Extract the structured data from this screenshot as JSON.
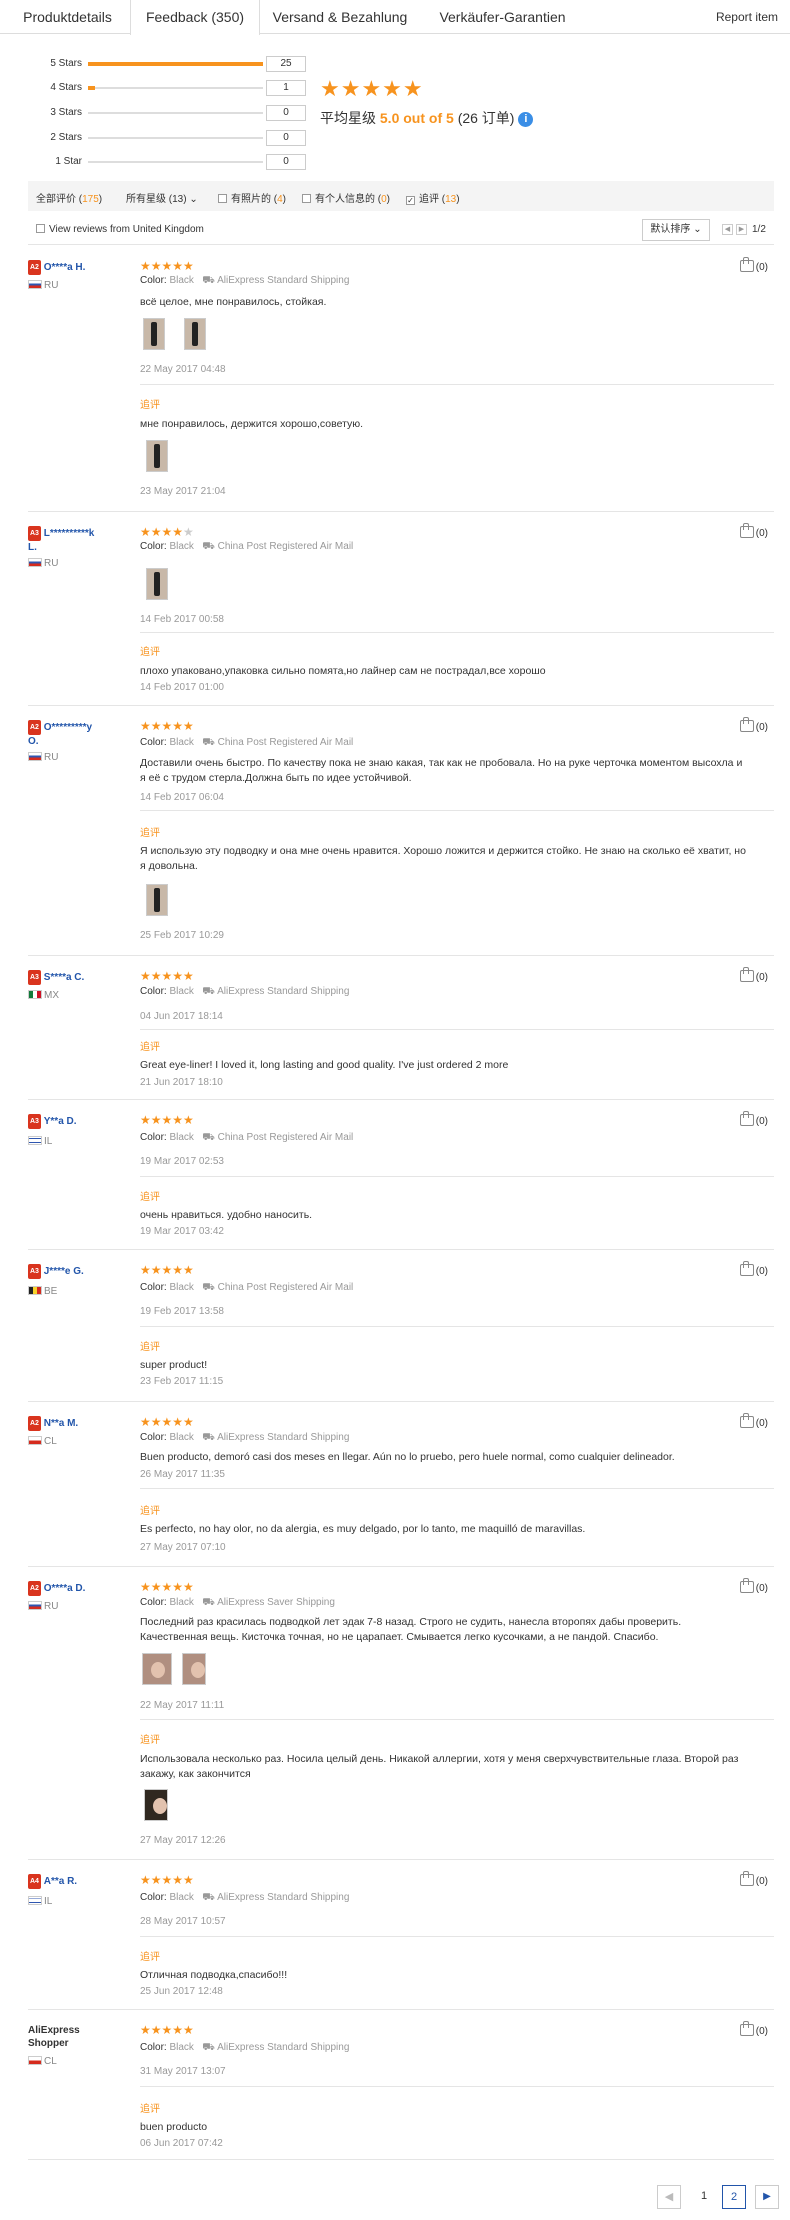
{
  "tabs": [
    "Produktdetails",
    "Feedback (350)",
    "Versand & Bezahlung",
    "Verkäufer-Garantien"
  ],
  "report_item": "Report item",
  "star_summary": [
    {
      "label": "5 Stars",
      "count": "25",
      "fraction": 1.0
    },
    {
      "label": "4 Stars",
      "count": "1",
      "fraction": 0.04
    },
    {
      "label": "3 Stars",
      "count": "0",
      "fraction": 0
    },
    {
      "label": "2 Stars",
      "count": "0",
      "fraction": 0
    },
    {
      "label": "1 Star",
      "count": "0",
      "fraction": 0
    }
  ],
  "average": {
    "prefix": "平均星级",
    "value": "5.0 out of 5",
    "orders": "(26 订单)",
    "stars": "★★★★★"
  },
  "filters": {
    "all_label": "全部评价 (",
    "all_count": "175",
    "all_close": ")",
    "all_stars": "所有星级 (13)",
    "with_photos": "有照片的 (",
    "with_photos_count": "4",
    "with_photos_close": ")",
    "with_personal": "有个人信息的 (",
    "with_personal_count": "0",
    "with_personal_close": ")",
    "additional": "追评 (",
    "additional_count": "13",
    "additional_close": ")"
  },
  "view_uk": "View reviews from United Kingdom",
  "sort_label": "默认排序",
  "page_count": "1/2",
  "labels": {
    "color": "Color:",
    "additional": "追评",
    "useful": "(0)"
  },
  "reviews": [
    {
      "level": "A2",
      "name": "O****a H.",
      "country": "RU",
      "stars": 5,
      "color": "Black",
      "shipping": "AliExpress Standard Shipping",
      "text": "всё целое, мне понравилось, стойкая.",
      "date": "22 May 2017 04:48",
      "add_text": "мне понравилось, держится хорошо,советую.",
      "add_date": "23 May 2017 21:04"
    },
    {
      "level": "A3",
      "name": "L**********k",
      "name2": "L.",
      "country": "RU",
      "stars": 4,
      "color": "Black",
      "shipping": "China Post Registered Air Mail",
      "text": "",
      "date": "14 Feb 2017 00:58",
      "add_text": "плохо упаковано,упаковка сильно помята,но лайнер сам не пострадал,все хорошо",
      "add_date": "14 Feb 2017 01:00"
    },
    {
      "level": "A2",
      "name": "O*********y",
      "name2": "O.",
      "country": "RU",
      "stars": 5,
      "color": "Black",
      "shipping": "China Post Registered Air Mail",
      "text": "Доставили очень быстро. По качеству пока не знаю какая, так как не пробовала. Но на руке черточка моментом высохла и я её с трудом стерла.Должна быть по идее устойчивой.",
      "date": "14 Feb 2017 06:04",
      "add_text": "Я использую эту подводку и она мне очень нравится. Хорошо ложится и держится стойко. Не знаю на сколько её хватит, но я довольна.",
      "add_date": "25 Feb 2017 10:29"
    },
    {
      "level": "A3",
      "name": "S****a C.",
      "country": "MX",
      "stars": 5,
      "color": "Black",
      "shipping": "AliExpress Standard Shipping",
      "text": "",
      "date": "04 Jun 2017 18:14",
      "add_text": "Great eye-liner! I loved it, long lasting and good quality. I've just ordered 2 more",
      "add_date": "21 Jun 2017 18:10"
    },
    {
      "level": "A3",
      "name": "Y**a D.",
      "country": "IL",
      "stars": 5,
      "color": "Black",
      "shipping": "China Post Registered Air Mail",
      "text": "",
      "date": "19 Mar 2017 02:53",
      "add_text": "очень нравиться. удобно наносить.",
      "add_date": "19 Mar 2017 03:42"
    },
    {
      "level": "A3",
      "name": "J****e G.",
      "country": "BE",
      "stars": 5,
      "color": "Black",
      "shipping": "China Post Registered Air Mail",
      "text": "",
      "date": "19 Feb 2017 13:58",
      "add_text": "super product!",
      "add_date": "23 Feb 2017 11:15"
    },
    {
      "level": "A2",
      "name": "N**a M.",
      "country": "CL",
      "stars": 5,
      "color": "Black",
      "shipping": "AliExpress Standard Shipping",
      "text": "Buen producto, demoró casi dos meses en llegar. Aún no lo pruebo, pero huele normal, como cualquier delineador.",
      "date": "26 May 2017 11:35",
      "add_text": "Es perfecto, no hay olor, no da alergia, es muy delgado, por lo tanto, me maquilló de maravillas.",
      "add_date": "27 May 2017 07:10"
    },
    {
      "level": "A2",
      "name": "O****a D.",
      "country": "RU",
      "stars": 5,
      "color": "Black",
      "shipping": "AliExpress Saver Shipping",
      "text": "Последний раз красилась подводкой лет эдак 7-8 назад. Строго не судить, нанесла второпях дабы проверить. Качественная вещь. Кисточка точная, но не царапает. Смывается легко кусочками, а не пандой. Спасибо.",
      "date": "22 May 2017 11:11",
      "add_text": "Использовала несколько раз. Носила целый день. Никакой аллергии, хотя у меня сверхчувствительные глаза. Второй раз закажу, как закончится",
      "add_date": "27 May 2017 12:26"
    },
    {
      "level": "A4",
      "name": "A**a R.",
      "country": "IL",
      "stars": 5,
      "color": "Black",
      "shipping": "AliExpress Standard Shipping",
      "text": "",
      "date": "28 May 2017 10:57",
      "add_text": "Отличная подводка,спасибо!!!",
      "add_date": "25 Jun 2017 12:48"
    },
    {
      "level": "",
      "name": "AliExpress",
      "name2": "Shopper",
      "country": "CL",
      "stars": 5,
      "color": "Black",
      "shipping": "AliExpress Standard Shipping",
      "text": "",
      "date": "31 May 2017 13:07",
      "add_text": "buen producto",
      "add_date": "06 Jun 2017 07:42"
    }
  ],
  "pagination": {
    "pages": [
      "1",
      "2"
    ],
    "current": "2"
  },
  "colors": {
    "accent": "#f7931e",
    "link": "#2255aa",
    "level_badge": "#d9341e"
  },
  "icons": {
    "thumbs_up": "thumbs-up-icon",
    "info": "info-icon",
    "prev": "chevron-left-icon",
    "next": "chevron-right-icon",
    "sort": "chevron-down-icon"
  }
}
